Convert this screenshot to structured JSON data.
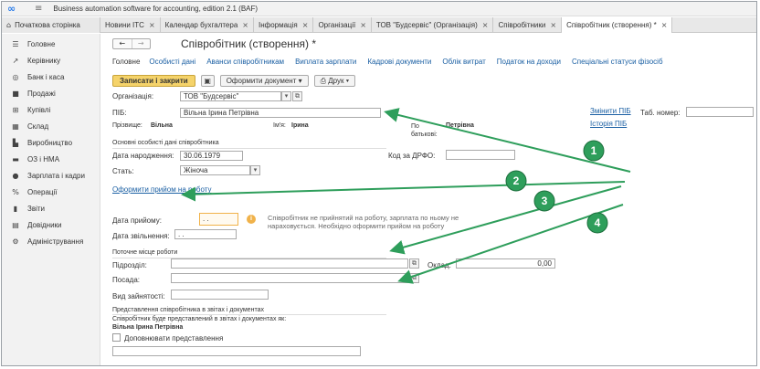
{
  "app": {
    "title": "Business automation software for accounting, edition 2.1  (BAF)"
  },
  "tabs": [
    {
      "label": "Початкова сторінка"
    },
    {
      "label": "Новини ІТС"
    },
    {
      "label": "Календар бухгалтера"
    },
    {
      "label": "Інформація"
    },
    {
      "label": "Організації"
    },
    {
      "label": "ТОВ \"Будсервіс\" (Організація)"
    },
    {
      "label": "Співробітники"
    },
    {
      "label": "Співробітник (створення) *"
    }
  ],
  "sidebar": {
    "items": [
      {
        "label": "Головне",
        "icon": "menu-lines-icon"
      },
      {
        "label": "Керівнику",
        "icon": "trend-icon"
      },
      {
        "label": "Банк і каса",
        "icon": "coin-icon"
      },
      {
        "label": "Продажі",
        "icon": "bag-icon"
      },
      {
        "label": "Купівлі",
        "icon": "cart-icon"
      },
      {
        "label": "Склад",
        "icon": "warehouse-icon"
      },
      {
        "label": "Виробництво",
        "icon": "factory-icon"
      },
      {
        "label": "ОЗ і НМА",
        "icon": "truck-icon"
      },
      {
        "label": "Зарплата і кадри",
        "icon": "person-icon"
      },
      {
        "label": "Операції",
        "icon": "percent-icon"
      },
      {
        "label": "Звіти",
        "icon": "bar-chart-icon"
      },
      {
        "label": "Довідники",
        "icon": "book-icon"
      },
      {
        "label": "Адміністрування",
        "icon": "gear-icon"
      }
    ]
  },
  "main": {
    "title": "Співробітник (створення) *",
    "sections": [
      "Головне",
      "Особисті дані",
      "Аванси співробітникам",
      "Виплата зарплати",
      "Кадрові документи",
      "Облік витрат",
      "Податок на доходи",
      "Спеціальні статуси фізосіб"
    ],
    "toolbar": {
      "save_close": "Записати і закрити",
      "create_doc": "Оформити документ",
      "print": "Друк"
    },
    "form": {
      "org_label": "Організація:",
      "org_value": "ТОВ \"Будсервіс\"",
      "pib_label": "ПІБ:",
      "pib_value": "Вільна Ірина Петрівна",
      "change_pib": "Змінити ПІБ",
      "history_pib": "Історія ПІБ",
      "tab_label": "Таб. номер:",
      "surname_label": "Прізвище:",
      "surname_value": "Вільна",
      "name_label": "Ім'я:",
      "name_value": "Ірина",
      "patronymic_label": "По батькові:",
      "patronymic_value": "Петрівна",
      "basic_title": "Основні особисті дані співробітника",
      "birth_label": "Дата народження:",
      "birth_value": "30.06.1979",
      "drfo_label": "Код за ДРФО:",
      "sex_label": "Стать:",
      "sex_value": "Жіноча",
      "hire_link": "Оформити прийом на роботу",
      "hire_date_label": "Дата прийому:",
      "hire_date_value": " .  .",
      "fire_date_label": "Дата звільнення:",
      "fire_date_value": " .  .",
      "note": "Співробітник не прийнятий на роботу, зарплата по ньому не нараховується. Необхідно оформити прийом на роботу",
      "workplace_title": "Поточне місце роботи",
      "dept_label": "Підрозділ:",
      "salary_label": "Оклад:",
      "salary_value": "0,00",
      "position_label": "Посада:",
      "employment_label": "Вид зайнятості:",
      "repr_title": "Представлення співробітника в звітах і документах",
      "repr_text": "Співробітник буде представлений в звітах і документах як:",
      "repr_value": "Вільна Ірина Петрівна",
      "repr_check": "Доповнювати представлення"
    }
  },
  "callouts": [
    "1",
    "2",
    "3",
    "4"
  ],
  "colors": {
    "callout": "#2e9e5b",
    "arrow": "#2e9e5b",
    "primary_btn": "#f5d36a",
    "link": "#1a5fa3"
  }
}
